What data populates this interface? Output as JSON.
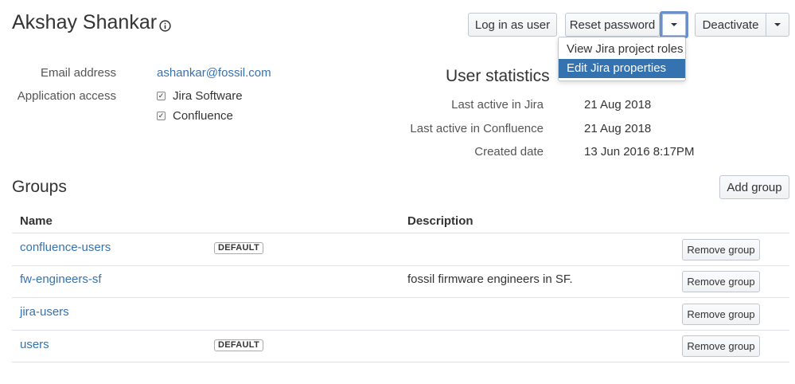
{
  "user": {
    "name": "Akshay Shankar",
    "info_icon": "info-circle-icon"
  },
  "actions": {
    "login_as_user": "Log in as user",
    "reset_password": "Reset password",
    "deactivate": "Deactivate",
    "dropdown_icon": "chevron-down-icon"
  },
  "dropdown_menu": {
    "items": [
      {
        "label": "View Jira project roles",
        "selected": false
      },
      {
        "label": "Edit Jira properties",
        "selected": true
      }
    ]
  },
  "details": {
    "email_label": "Email address",
    "email_value": "ashankar@fossil.com",
    "app_access_label": "Application access",
    "apps": [
      {
        "label": "Jira Software",
        "checked": true
      },
      {
        "label": "Confluence",
        "checked": true
      }
    ]
  },
  "stats": {
    "title": "User statistics",
    "rows": [
      {
        "label": "Last active in Jira",
        "value": "21 Aug 2018"
      },
      {
        "label": "Last active in Confluence",
        "value": "21 Aug 2018"
      },
      {
        "label": "Created date",
        "value": "13 Jun 2016 8:17PM"
      }
    ]
  },
  "groups": {
    "title": "Groups",
    "add_button": "Add group",
    "columns": [
      "Name",
      "Description"
    ],
    "remove_label": "Remove group",
    "rows": [
      {
        "name": "confluence-users",
        "badge": "DEFAULT",
        "description": ""
      },
      {
        "name": "fw-engineers-sf",
        "badge": "",
        "description": "fossil firmware engineers in SF."
      },
      {
        "name": "jira-users",
        "badge": "",
        "description": ""
      },
      {
        "name": "users",
        "badge": "DEFAULT",
        "description": ""
      }
    ]
  },
  "colors": {
    "link": "#3572b0",
    "menu_highlight": "#3572b0"
  }
}
